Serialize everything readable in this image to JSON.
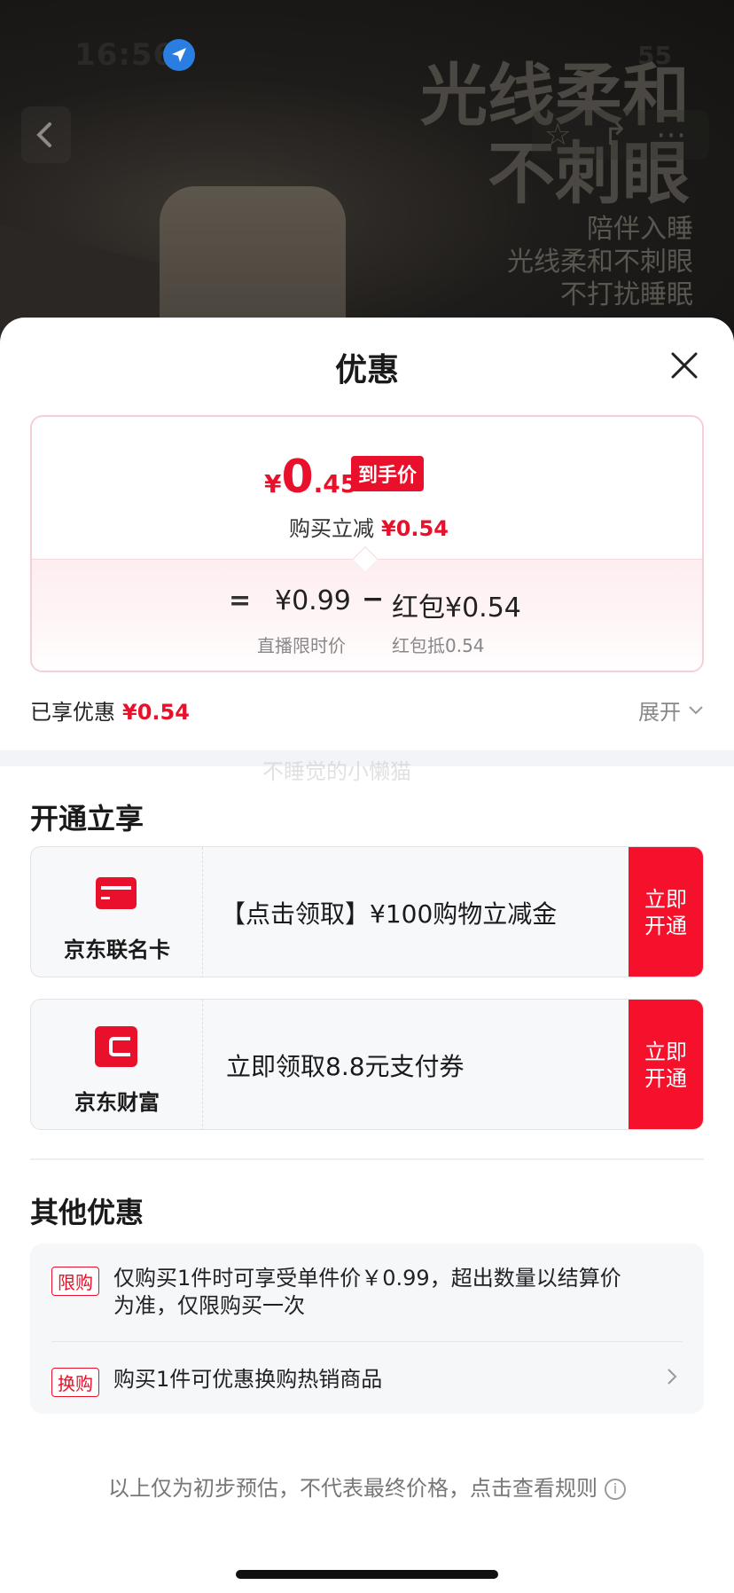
{
  "status_bar": {
    "time": "16:56",
    "right": "55"
  },
  "hero": {
    "title_line1": "光线柔和",
    "title_line2": "不刺眼",
    "sub_line1": "陪伴入睡",
    "sub_line2": "光线柔和不刺眼",
    "sub_line3": "不打扰睡眠",
    "icons": [
      "back-arrow-icon",
      "star-icon",
      "share-icon",
      "more-icon"
    ]
  },
  "sheet": {
    "title": "优惠",
    "price_card": {
      "currency": "¥",
      "price_int": "0",
      "price_dec": ".45",
      "tag": "到手价",
      "reduce_label": "购买立减",
      "reduce_amount": "¥0.54",
      "equals": "=",
      "item_a_value": "¥0.99",
      "item_a_label": "直播限时价",
      "minus": "−",
      "item_b_value": "红包¥0.54",
      "item_b_label": "红包抵0.54"
    },
    "enjoyed_label": "已享优惠",
    "enjoyed_amount": "¥0.54",
    "expand_label": "展开",
    "watermark": "不睡觉的小懒猫",
    "open_section_title": "开通立享",
    "offers": [
      {
        "name": "京东联名卡",
        "desc": "【点击领取】¥100购物立减金",
        "btn_line1": "立即",
        "btn_line2": "开通"
      },
      {
        "name": "京东财富",
        "desc": "立即领取8.8元支付券",
        "btn_line1": "立即",
        "btn_line2": "开通"
      }
    ],
    "other_section_title": "其他优惠",
    "other_items": [
      {
        "tag": "限购",
        "text_line1": "仅购买1件时可享受单件价￥0.99，超出数量以结算价",
        "text_line2": "为准，仅限购买一次"
      },
      {
        "tag": "换购",
        "text_line1": "购买1件可优惠换购热销商品"
      }
    ],
    "footnote": "以上仅为初步预估，不代表最终价格，点击查看规则"
  },
  "colors": {
    "accent": "#e8102b",
    "button": "#f5112c"
  }
}
